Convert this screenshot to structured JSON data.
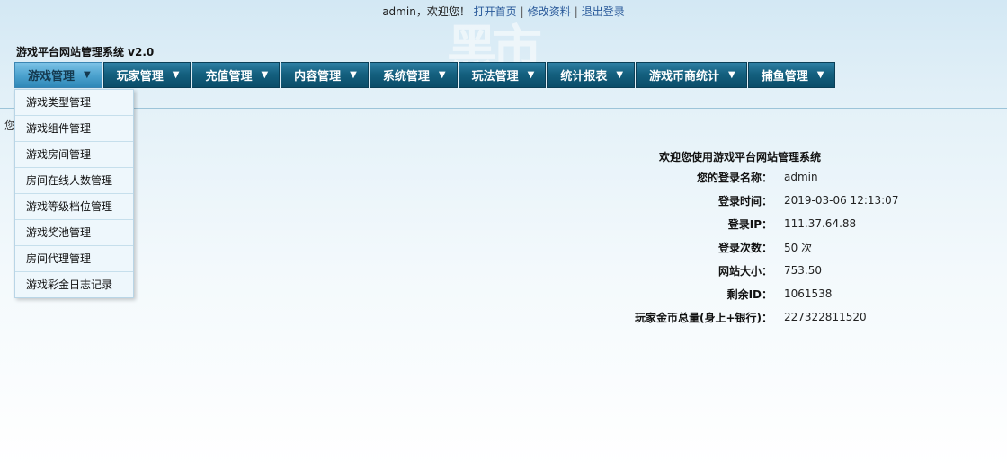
{
  "watermark": "黑市",
  "topbar": {
    "username": "admin",
    "greeting": "，欢迎您！",
    "links": [
      "打开首页",
      "修改资料",
      "退出登录"
    ],
    "separator": "|"
  },
  "brand": {
    "title": "游戏平台网站管理系统 v2.0"
  },
  "nav": {
    "caret": "▼",
    "items": [
      "游戏管理",
      "玩家管理",
      "充值管理",
      "内容管理",
      "系统管理",
      "玩法管理",
      "统计报表",
      "游戏币商统计",
      "捕鱼管理"
    ]
  },
  "dropdown": {
    "items": [
      "游戏类型管理",
      "游戏组件管理",
      "游戏房间管理",
      "房间在线人数管理",
      "游戏等级档位管理",
      "游戏奖池管理",
      "房间代理管理",
      "游戏彩金日志记录"
    ]
  },
  "main": {
    "left_partial": "您",
    "welcome": "欢迎您使用游戏平台网站管理系统",
    "rows": [
      {
        "label": "您的登录名称：",
        "value": "admin"
      },
      {
        "label": "登录时间：",
        "value": "2019-03-06 12:13:07"
      },
      {
        "label": "登录IP：",
        "value": "111.37.64.88"
      },
      {
        "label": "登录次数：",
        "value": "50 次"
      },
      {
        "label": "网站大小：",
        "value": "753.50"
      },
      {
        "label": "剩余ID：",
        "value": "1061538"
      },
      {
        "label": "玩家金币总量(身上+银行)：",
        "value": "227322811520"
      }
    ]
  }
}
